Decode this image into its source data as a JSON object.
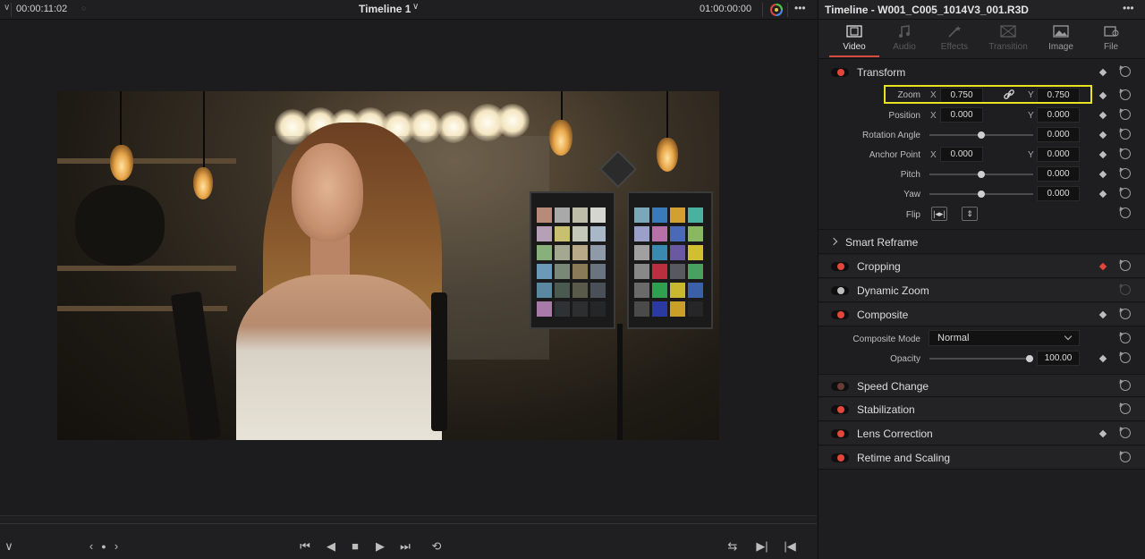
{
  "viewer": {
    "source_timecode": "00:00:11:02",
    "timeline_name": "Timeline 1",
    "record_timecode": "01:00:00:00",
    "more_label": "•••"
  },
  "inspector": {
    "title": "Timeline - W001_C005_1014V3_001.R3D",
    "more_label": "•••",
    "tabs": [
      {
        "label": "Video",
        "icon": "film-icon",
        "active": true
      },
      {
        "label": "Audio",
        "icon": "music-note-icon",
        "active": false
      },
      {
        "label": "Effects",
        "icon": "magic-wand-icon",
        "active": false
      },
      {
        "label": "Transition",
        "icon": "transition-icon",
        "active": false
      },
      {
        "label": "Image",
        "icon": "image-icon",
        "active": false
      },
      {
        "label": "File",
        "icon": "file-icon",
        "active": false
      }
    ],
    "transform": {
      "label": "Transform",
      "zoom": {
        "label": "Zoom",
        "x_axis": "X",
        "x": "0.750",
        "y_axis": "Y",
        "y": "0.750"
      },
      "position": {
        "label": "Position",
        "x_axis": "X",
        "x": "0.000",
        "y_axis": "Y",
        "y": "0.000"
      },
      "rotation": {
        "label": "Rotation Angle",
        "value": "0.000"
      },
      "anchor": {
        "label": "Anchor Point",
        "x_axis": "X",
        "x": "0.000",
        "y_axis": "Y",
        "y": "0.000"
      },
      "pitch": {
        "label": "Pitch",
        "value": "0.000"
      },
      "yaw": {
        "label": "Yaw",
        "value": "0.000"
      },
      "flip": {
        "label": "Flip"
      }
    },
    "smart_reframe": {
      "label": "Smart Reframe"
    },
    "cropping": {
      "label": "Cropping"
    },
    "dynamic_zoom": {
      "label": "Dynamic Zoom"
    },
    "composite": {
      "label": "Composite",
      "mode_label": "Composite Mode",
      "mode_value": "Normal",
      "opacity_label": "Opacity",
      "opacity_value": "100.00",
      "opacity_level": 1.0
    },
    "speed_change": {
      "label": "Speed Change"
    },
    "stabilization": {
      "label": "Stabilization"
    },
    "lens_correction": {
      "label": "Lens Correction"
    },
    "retime_scaling": {
      "label": "Retime and Scaling"
    }
  },
  "colors": {
    "accent_red": "#e2473a",
    "highlight_yellow": "#e8e320"
  }
}
